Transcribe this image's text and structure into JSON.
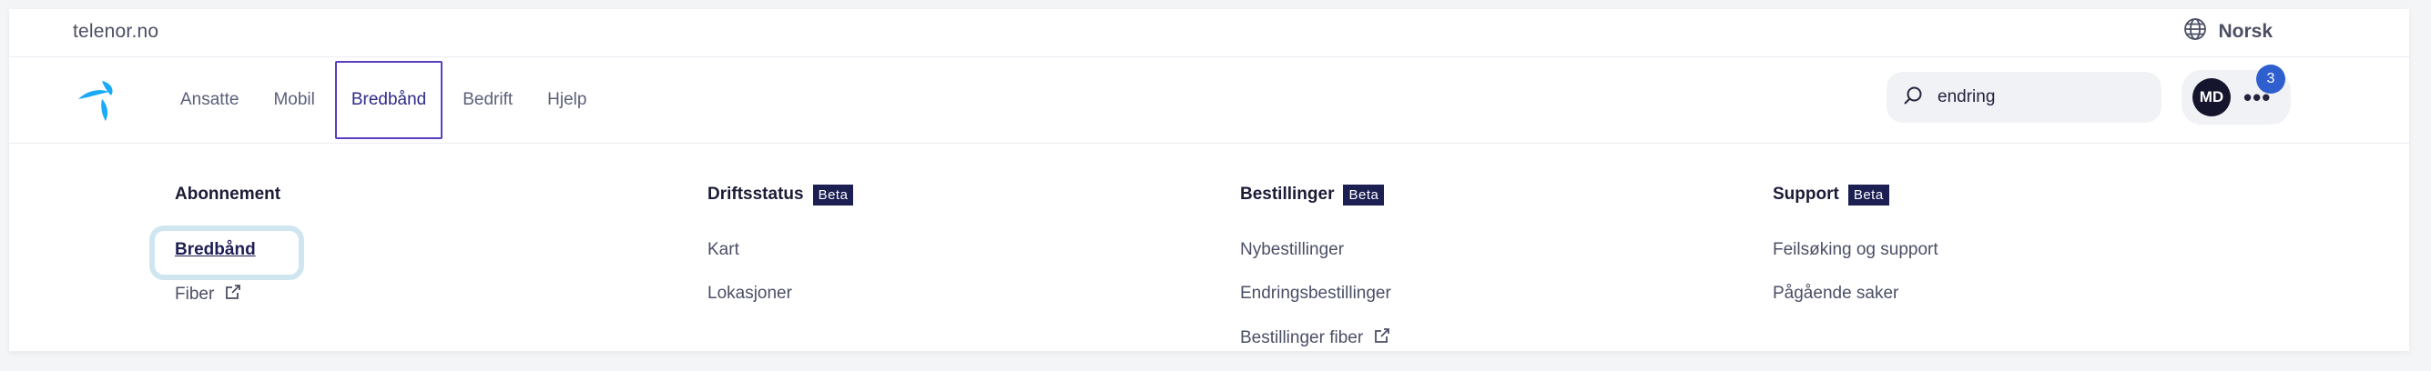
{
  "topbar": {
    "site_name": "telenor.no",
    "language": "Norsk"
  },
  "nav": {
    "items": [
      {
        "label": "Ansatte",
        "active": false
      },
      {
        "label": "Mobil",
        "active": false
      },
      {
        "label": "Bredbånd",
        "active": true
      },
      {
        "label": "Bedrift",
        "active": false
      },
      {
        "label": "Hjelp",
        "active": false
      }
    ],
    "search_value": "endring",
    "user_initials": "MD",
    "more_label": "•••",
    "notification_count": "3"
  },
  "menu": {
    "columns": [
      {
        "title": "Abonnement",
        "badge": "",
        "links": [
          {
            "label": "Bredbånd",
            "external": false,
            "current": true
          },
          {
            "label": "Fiber",
            "external": true,
            "current": false
          }
        ]
      },
      {
        "title": "Driftsstatus",
        "badge": "Beta",
        "links": [
          {
            "label": "Kart",
            "external": false
          },
          {
            "label": "Lokasjoner",
            "external": false
          }
        ]
      },
      {
        "title": "Bestillinger",
        "badge": "Beta",
        "links": [
          {
            "label": "Nybestillinger",
            "external": false
          },
          {
            "label": "Endringsbestillinger",
            "external": false
          },
          {
            "label": "Bestillinger fiber",
            "external": true
          }
        ]
      },
      {
        "title": "Support",
        "badge": "Beta",
        "links": [
          {
            "label": "Feilsøking og support",
            "external": false
          },
          {
            "label": "Pågående saker",
            "external": false
          }
        ]
      }
    ]
  },
  "colors": {
    "accent": "#5a3fbf",
    "brand": "#19aaf8",
    "badge": "#2f5fcf",
    "dark": "#1b1f52"
  }
}
